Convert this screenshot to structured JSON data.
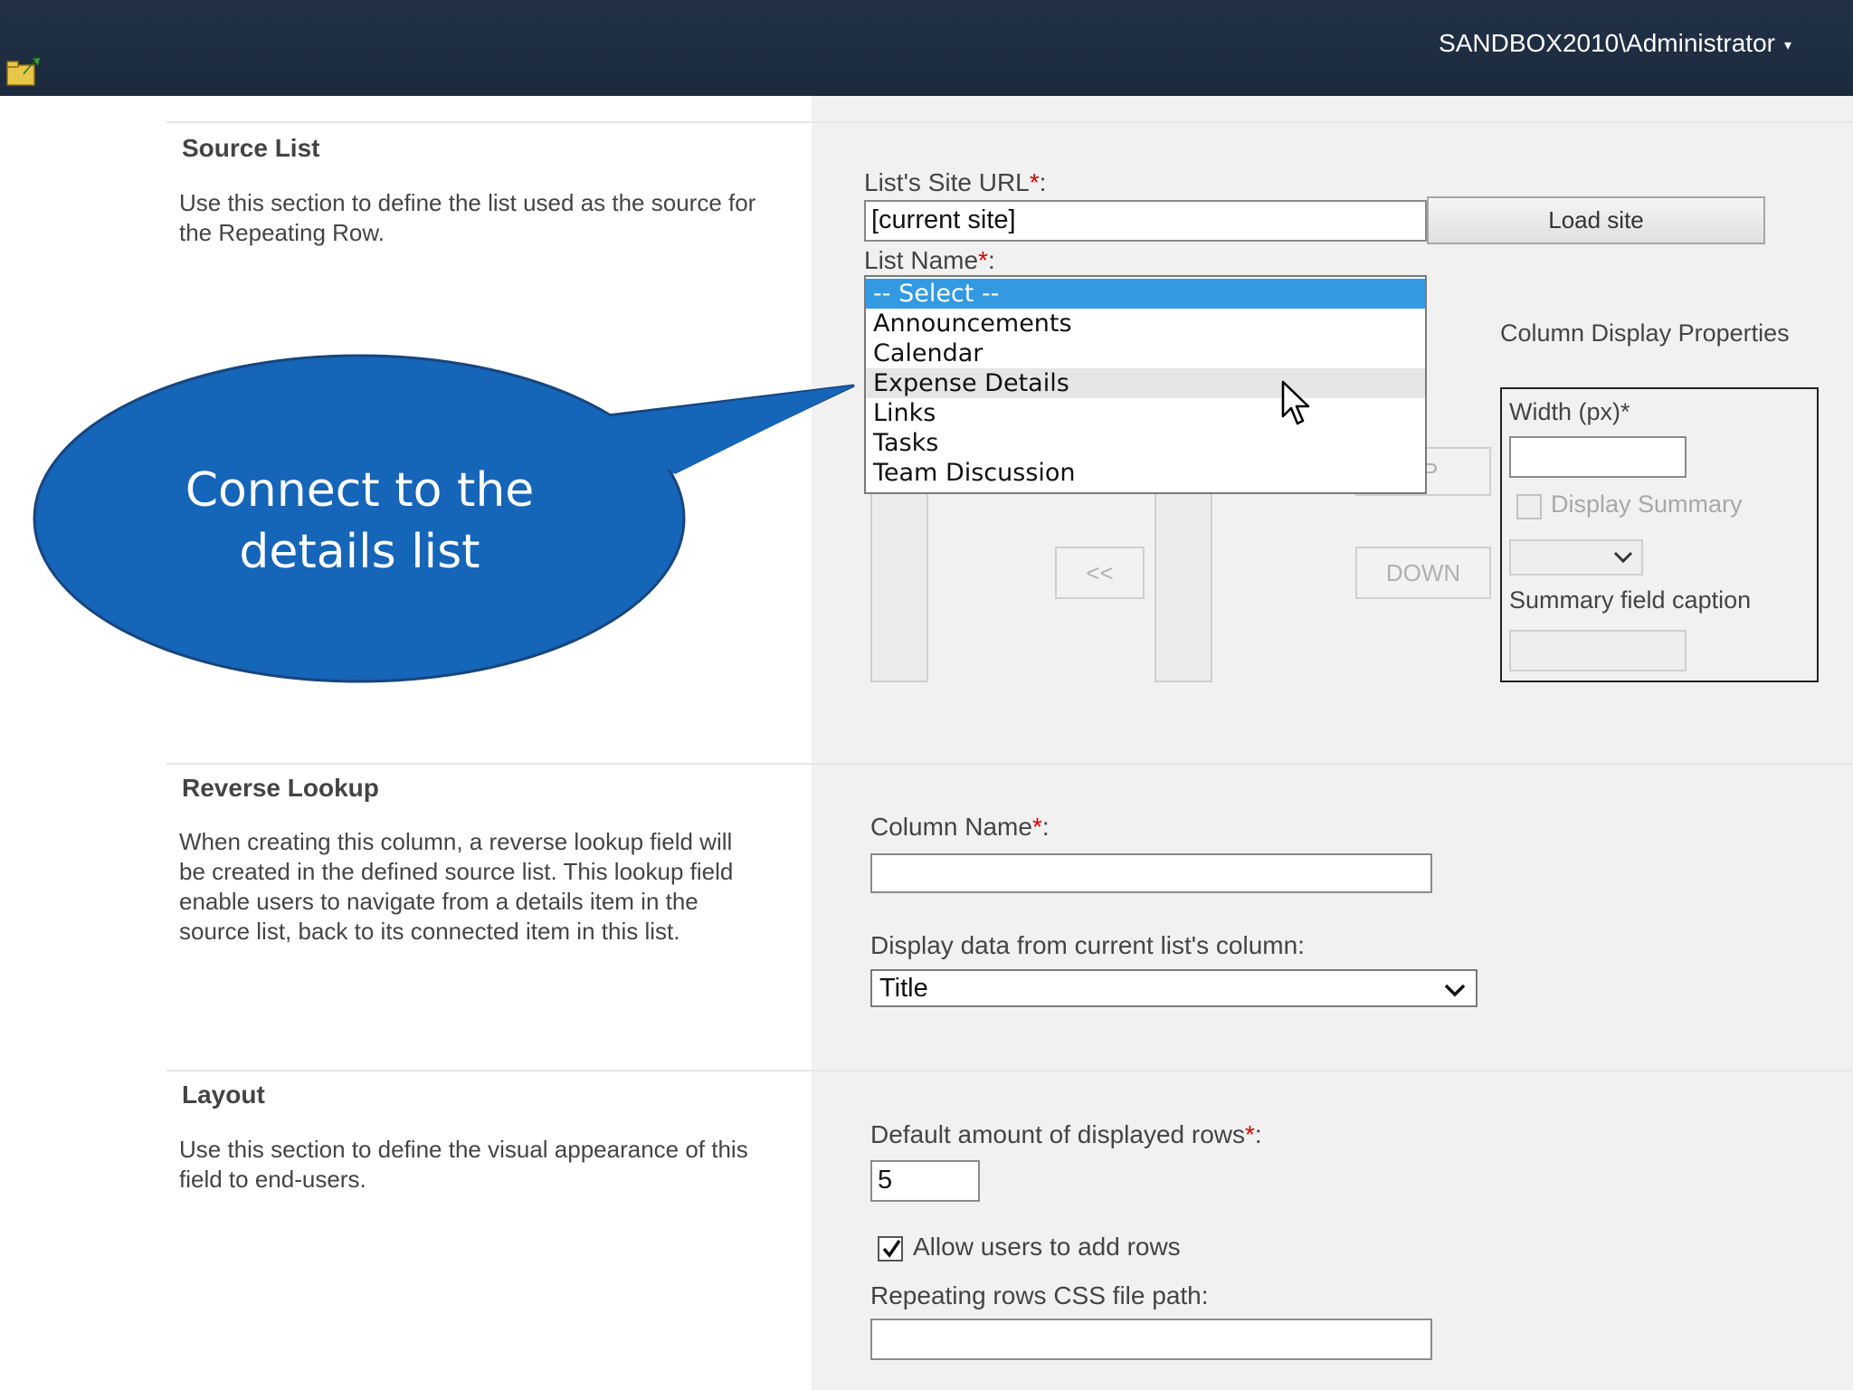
{
  "header": {
    "user": "SANDBOX2010\\Administrator",
    "user_caret": "▾"
  },
  "source_list": {
    "title": "Source List",
    "description": "Use this section to define the list used as the source for the Repeating Row.",
    "site_url_label": "List's Site URL",
    "site_url_value": "[current site]",
    "load_site_label": "Load site",
    "list_name_label": "List Name",
    "list_options": [
      "-- Select --",
      "Announcements",
      "Calendar",
      "Expense Details",
      "Links",
      "Tasks",
      "Team Discussion"
    ],
    "selected_index": 0,
    "hover_index": 3,
    "move_left_label": "<<",
    "up_fragment": "P",
    "down_label": "DOWN",
    "column_display": {
      "heading": "Column Display Properties",
      "width_label": "Width (px)*",
      "display_summary_label": "Display Summary",
      "summary_caption_label": "Summary field caption"
    }
  },
  "callout": {
    "text": "Connect to the details list",
    "color": "#1565b8"
  },
  "reverse_lookup": {
    "title": "Reverse Lookup",
    "description": "When creating this column, a reverse lookup field will be created in the defined source list. This lookup field enable users to navigate from a details item in the source list, back to its connected item in this list.",
    "column_name_label": "Column Name",
    "display_data_label": "Display data from current list's column:",
    "display_data_value": "Title"
  },
  "layout": {
    "title": "Layout",
    "description": "Use this section to define the visual appearance of this field to end-users.",
    "default_rows_label": "Default amount of displayed rows",
    "default_rows_value": "5",
    "allow_add_rows_label": "Allow users to add rows",
    "allow_add_rows_checked": true,
    "css_path_label": "Repeating rows CSS file path:"
  },
  "required_marker": "*",
  "colon": ":"
}
